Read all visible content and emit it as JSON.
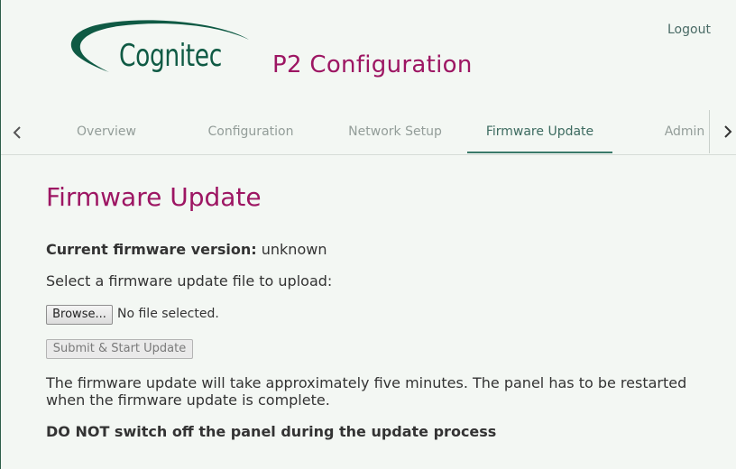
{
  "header": {
    "logo_text": "Cognitec",
    "title": "P2 Configuration",
    "logout_label": "Logout"
  },
  "tabs": [
    {
      "label": "Overview",
      "active": false
    },
    {
      "label": "Configuration",
      "active": false
    },
    {
      "label": "Network Setup",
      "active": false
    },
    {
      "label": "Firmware Update",
      "active": true
    },
    {
      "label": "Admin",
      "active": false
    }
  ],
  "main": {
    "heading": "Firmware Update",
    "version_label": "Current firmware version:",
    "version_value": "unknown",
    "select_label": "Select a firmware update file to upload:",
    "browse_label": "Browse...",
    "no_file_label": "No file selected.",
    "submit_label": "Submit & Start Update",
    "info_text": "The firmware update will take approximately five minutes. The panel has to be restarted when the firmware update is complete.",
    "warning_text": "DO NOT switch off the panel during the update process"
  },
  "colors": {
    "accent_title": "#9d1663",
    "brand_green": "#0f5a44",
    "background": "#f3f7f3",
    "active_tab": "#3d6b60"
  },
  "icons": {
    "logo": "cognitec-swoosh-logo",
    "scroll_left": "chevron-left-icon",
    "scroll_right": "chevron-right-icon"
  }
}
